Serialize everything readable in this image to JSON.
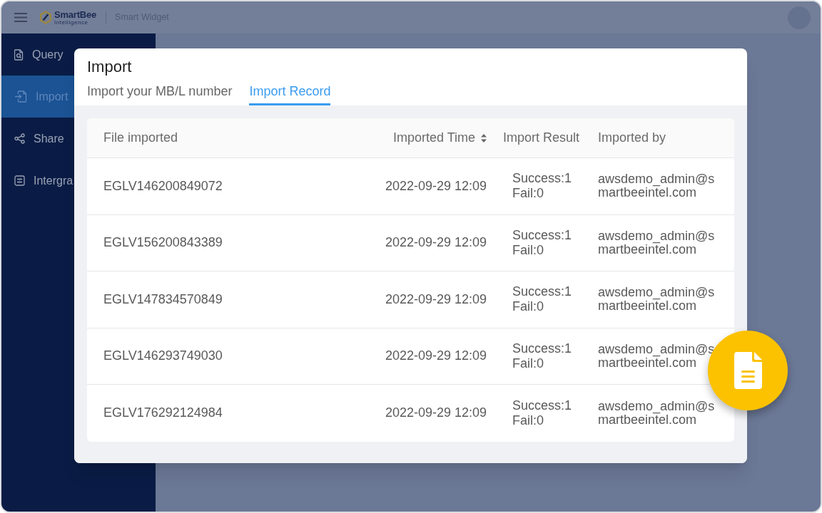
{
  "header": {
    "logo": {
      "name": "SmartBee",
      "tagline": "Intelligence"
    },
    "app_title": "Smart Widget"
  },
  "sidebar": {
    "items": [
      {
        "label": "Query",
        "selected": false
      },
      {
        "label": "Import",
        "selected": true
      },
      {
        "label": "Share",
        "selected": false
      },
      {
        "label": "Intergra",
        "selected": false
      }
    ]
  },
  "dialog": {
    "title": "Import",
    "tabs": [
      {
        "label": "Import your MB/L number",
        "selected": false
      },
      {
        "label": "Import Record",
        "selected": true
      }
    ],
    "table": {
      "columns": [
        {
          "label": "File imported",
          "sortable": false
        },
        {
          "label": "Imported Time",
          "sortable": true
        },
        {
          "label": "Import Result",
          "sortable": false
        },
        {
          "label": "Imported by",
          "sortable": false
        }
      ],
      "rows": [
        {
          "file": "EGLV146200849072",
          "time": "2022-09-29 12:09",
          "success": "Success:1",
          "fail": "Fail:0",
          "imported_by": "awsdemo_admin@smartbeeintel.com"
        },
        {
          "file": "EGLV156200843389",
          "time": "2022-09-29 12:09",
          "success": "Success:1",
          "fail": "Fail:0",
          "imported_by": "awsdemo_admin@smartbeeintel.com"
        },
        {
          "file": "EGLV147834570849",
          "time": "2022-09-29 12:09",
          "success": "Success:1",
          "fail": "Fail:0",
          "imported_by": "awsdemo_admin@smartbeeintel.com"
        },
        {
          "file": "EGLV146293749030",
          "time": "2022-09-29 12:09",
          "success": "Success:1",
          "fail": "Fail:0",
          "imported_by": "awsdemo_admin@smartbeeintel.com"
        },
        {
          "file": "EGLV176292124984",
          "time": "2022-09-29 12:09",
          "success": "Success:1",
          "fail": "Fail:0",
          "imported_by": "awsdemo_admin@smartbeeintel.com"
        }
      ]
    }
  }
}
